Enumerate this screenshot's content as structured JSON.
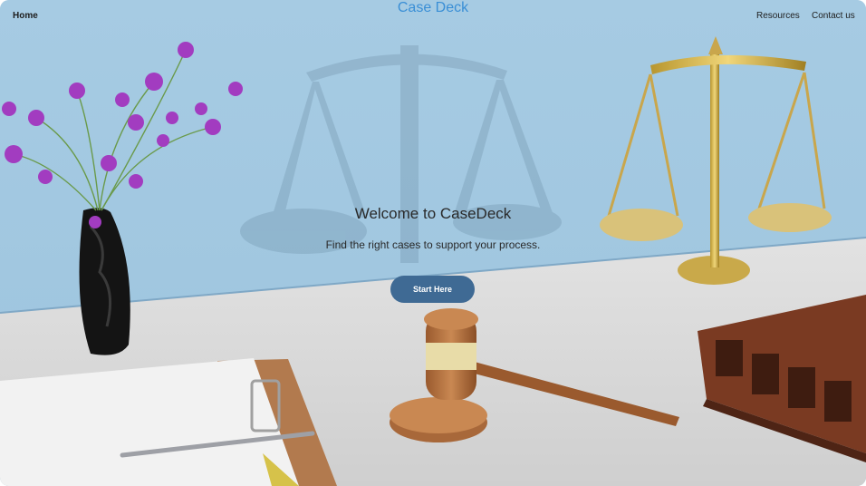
{
  "nav": {
    "home": "Home",
    "brand": "Case Deck",
    "resources": "Resources",
    "contact": "Contact us"
  },
  "hero": {
    "title": "Welcome to CaseDeck",
    "subtitle": "Find the right cases to support your process.",
    "cta": "Start Here"
  },
  "colors": {
    "wall": "#a9cde4",
    "desk": "#d9d9d9",
    "brand": "#3a8fd6",
    "cta": "#3f6a94"
  }
}
